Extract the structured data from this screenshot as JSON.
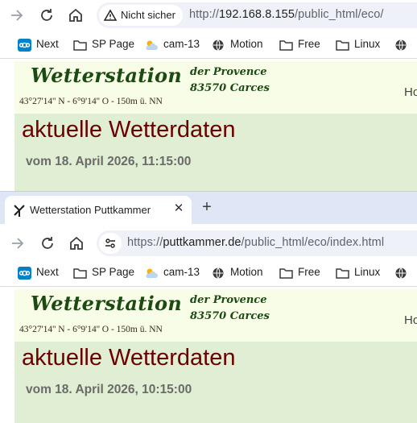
{
  "browser": {
    "bookmarks": [
      {
        "label": "Next",
        "icon": "nextcloud-icon"
      },
      {
        "label": "SP Page",
        "icon": "folder-icon"
      },
      {
        "label": "cam-13",
        "icon": "weather-icon"
      },
      {
        "label": "Motion",
        "icon": "globe-icon"
      },
      {
        "label": "Free",
        "icon": "folder-icon"
      },
      {
        "label": "Linux",
        "icon": "folder-icon"
      }
    ]
  },
  "top_window": {
    "security_chip": "Nicht sicher",
    "url_scheme": "http://",
    "url_host": "192.168.8.155",
    "url_path": "/public_html/eco/",
    "page": {
      "site_title": "Wetterstation",
      "subline_1": "der Provence",
      "subline_2": "83570 Carces",
      "coords": "43°27'14'' N - 6°9'14'' O - 150m ü. NN",
      "nav_fragment": "Ho",
      "heading": "aktuelle Wetterdaten",
      "date": "vom 18. April 2026, 11:15:00"
    }
  },
  "bottom_window": {
    "tab_title": "Wetterstation Puttkammer",
    "tab_close": "✕",
    "new_tab": "+",
    "url_scheme": "https://",
    "url_host": "puttkammer.de",
    "url_path": "/public_html/eco/index.html",
    "page": {
      "site_title": "Wetterstation",
      "subline_1": "der Provence",
      "subline_2": "83570 Carces",
      "coords": "43°27'14'' N - 6°9'14'' O - 150m ü. NN",
      "nav_fragment": "Ho",
      "heading": "aktuelle Wetterdaten",
      "date": "vom 18. April 2026, 10:15:00"
    }
  },
  "colors": {
    "header_bg": "#f7fde7",
    "content_bg": "#e0efd3",
    "title_green": "#1c4a12",
    "heading_red": "#6b0000"
  }
}
